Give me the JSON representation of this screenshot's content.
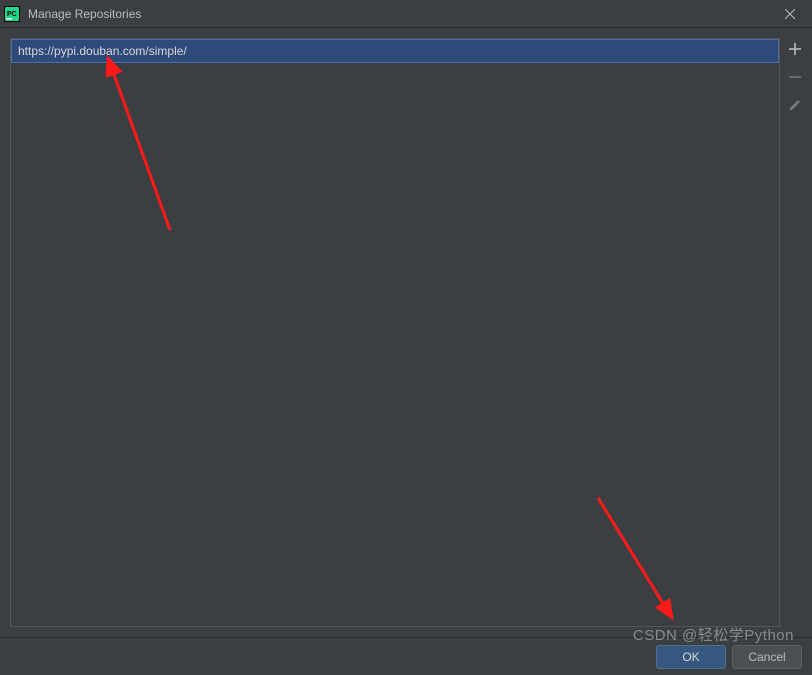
{
  "window": {
    "title": "Manage Repositories"
  },
  "repositories": {
    "items": [
      {
        "url": "https://pypi.douban.com/simple/",
        "selected": true
      }
    ]
  },
  "actions": {
    "ok_label": "OK",
    "cancel_label": "Cancel"
  },
  "watermark": "CSDN @轻松学Python"
}
